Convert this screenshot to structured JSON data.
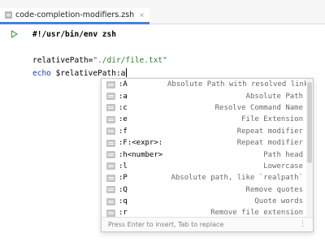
{
  "tab": {
    "label": "code-completion-modifiers.zsh",
    "close": "×"
  },
  "code": {
    "line1": "#!/usr/bin/env zsh",
    "line3_var": "relativePath=",
    "line3_str": "\"./dir/file.txt\"",
    "line4_kw": "echo",
    "line4_rest": " $relativePath:a"
  },
  "completion": {
    "items": [
      {
        "name": ":A",
        "desc": "Absolute Path with resolved links"
      },
      {
        "name": ":a",
        "desc": "Absolute Path"
      },
      {
        "name": ":c",
        "desc": "Resolve Command Name"
      },
      {
        "name": ":e",
        "desc": "File Extension"
      },
      {
        "name": ":f",
        "desc": "Repeat modifier"
      },
      {
        "name": ":F:<expr>:",
        "desc": "Repeat modifier"
      },
      {
        "name": ":h<number>",
        "desc": "Path head"
      },
      {
        "name": ":l",
        "desc": "Lowercase"
      },
      {
        "name": ":P",
        "desc": "Absolute path, like `realpath`"
      },
      {
        "name": ":Q",
        "desc": "Remove quotes"
      },
      {
        "name": ":q",
        "desc": "Quote words"
      },
      {
        "name": ":r",
        "desc": "Remove file extension"
      }
    ],
    "footer": "Press Enter to insert, Tab to replace",
    "more": "⋮"
  }
}
